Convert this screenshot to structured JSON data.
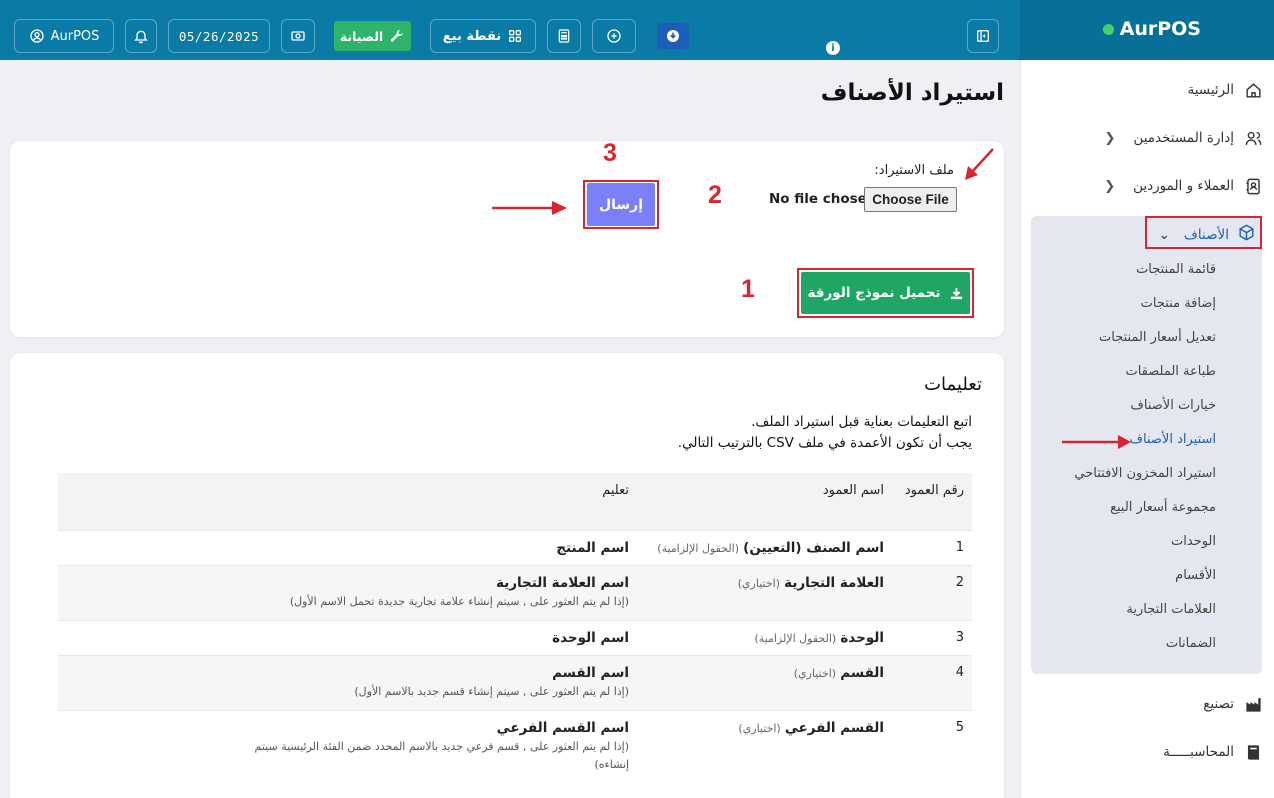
{
  "header": {
    "brand": "AurPOS",
    "user_label": "AurPOS",
    "date": "05/26/2025",
    "maintenance_label": "الصيانة",
    "pos_label": "نقطة بيع"
  },
  "sidebar": {
    "items": [
      {
        "label": "الرئيسية",
        "icon": "home-icon"
      },
      {
        "label": "إدارة المستخدمين",
        "icon": "users-icon"
      },
      {
        "label": "العملاء و الموردين",
        "icon": "address-book-icon"
      },
      {
        "label": "الأصناف",
        "icon": "box-icon"
      },
      {
        "label": "تصنيع",
        "icon": "factory-icon"
      },
      {
        "label": "المحاسبـــــة",
        "icon": "book-icon"
      }
    ],
    "subitems": [
      "قائمة المنتجات",
      "إضافة منتجات",
      "تعديل أسعار المنتجات",
      "طباعة الملصقات",
      "خيارات الأصناف",
      "استيراد الأصناف",
      "استيراد المخزون الافتتاحي",
      "مجموعة أسعار البيع",
      "الوحدات",
      "الأقسام",
      "العلامات التجارية",
      "الضمانات"
    ]
  },
  "page": {
    "title": "استيراد الأصناف"
  },
  "import_form": {
    "file_label": "ملف الاستيراد:",
    "choose_file": "Choose File",
    "no_file": "No file chosen",
    "submit": "إرسال",
    "download_template": "تحميل نموذج الورقة",
    "markers": [
      "1",
      "2",
      "3"
    ]
  },
  "instructions": {
    "title": "تعليمات",
    "line1": "اتبع التعليمات بعناية قبل استيراد الملف.",
    "line2": "يجب أن تكون الأعمدة في ملف CSV بالترتيب التالي.",
    "headers": {
      "no": "رقم العمود",
      "name": "اسم العمود",
      "instruction": "تعليم"
    },
    "rows": [
      {
        "no": "1",
        "name": "اسم الصنف (التعيين)",
        "tag": "(الحقول الإلزامية)",
        "value": "اسم المنتج",
        "note": ""
      },
      {
        "no": "2",
        "name": "العلامة التجارية",
        "tag": "(اختياري)",
        "value": "اسم العلامة التجارية",
        "note": "(إذا لم يتم العثور على , سيتم إنشاء علامة تجارية جديدة تحمل الاسم الأول)"
      },
      {
        "no": "3",
        "name": "الوحدة",
        "tag": "(الحقول الإلزامية)",
        "value": "اسم الوحدة",
        "note": ""
      },
      {
        "no": "4",
        "name": "القسم",
        "tag": "(اختياري)",
        "value": "اسم القسم",
        "note": "(إذا لم يتم العثور على , سيتم إنشاء قسم جديد بالاسم الأول)"
      },
      {
        "no": "5",
        "name": "القسم الفرعي",
        "tag": "(اختياري)",
        "value": "اسم القسم الفرعي",
        "note": "(إذا لم يتم العثور على , قسم فرعي جديد بالاسم المحدد ضمن الفئة الرئيسية سيتم إنشاءه)"
      }
    ]
  },
  "colors": {
    "header": "#0a7aa6",
    "maintenance": "#2db36a",
    "submit": "#7b7ff8",
    "download": "#1fa564",
    "annotation": "#d7262d",
    "active_link": "#1d5fb8"
  }
}
